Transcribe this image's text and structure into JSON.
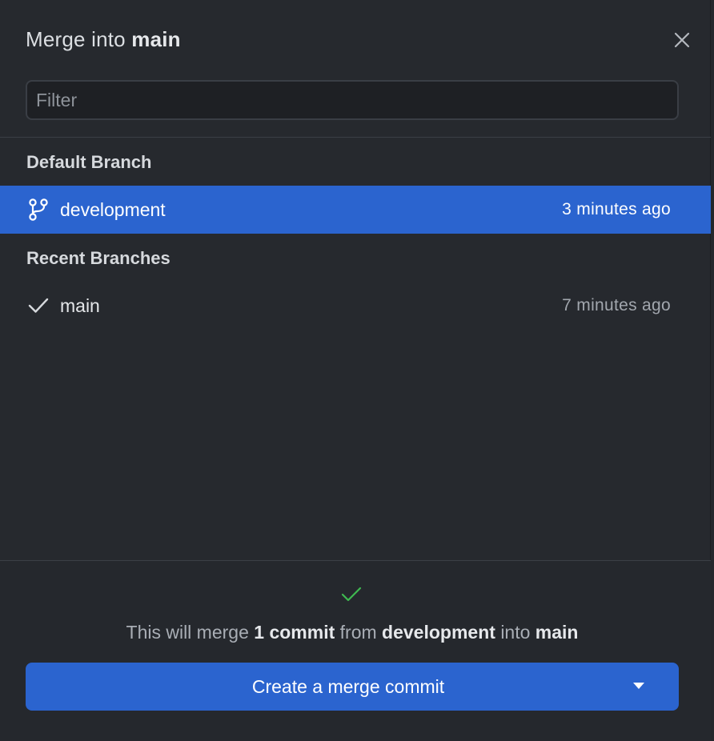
{
  "dialog": {
    "title_prefix": "Merge into",
    "title_branch": "main",
    "close_icon": "close-icon"
  },
  "filter": {
    "placeholder": "Filter",
    "value": ""
  },
  "sections": {
    "default_branch": {
      "header": "Default Branch",
      "items": [
        {
          "name": "development",
          "time": "3 minutes ago",
          "icon": "git-branch-icon",
          "selected": true
        }
      ]
    },
    "recent_branches": {
      "header": "Recent Branches",
      "items": [
        {
          "name": "main",
          "time": "7 minutes ago",
          "icon": "check-icon",
          "selected": false
        }
      ]
    }
  },
  "footer": {
    "status_icon": "success-check-icon",
    "message": {
      "part1": "This will merge",
      "count": "1 commit",
      "part2": "from",
      "source": "development",
      "part3": "into",
      "target": "main"
    },
    "button_label": "Create a merge commit",
    "button_dropdown_icon": "caret-down-icon"
  },
  "colors": {
    "accent": "#2b64cf",
    "background": "#26292e",
    "success": "#3fb950"
  }
}
